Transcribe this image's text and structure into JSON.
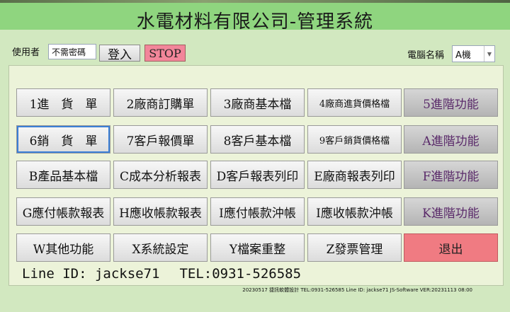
{
  "title": "水電材料有限公司-管理系統",
  "login": {
    "user_label": "使用者",
    "password_value": "不需密碼",
    "login_label": "登入",
    "stop_label": "STOP"
  },
  "computer": {
    "label": "電腦名稱",
    "selected": "A機"
  },
  "menu": [
    [
      "1進　貨　單",
      "2廠商訂購單",
      "3廠商基本檔",
      "4廠商進貨價格檔",
      "5進階功能"
    ],
    [
      "6銷　貨　單",
      "7客戶報價單",
      "8客戶基本檔",
      "9客戶銷貨價格檔",
      "A進階功能"
    ],
    [
      "B產品基本檔",
      "C成本分析報表",
      "D客戶報表列印",
      "E廠商報表列印",
      "F進階功能"
    ],
    [
      "G應付帳款報表",
      "H應收帳款報表",
      "I應付帳款沖帳",
      "I應收帳款沖帳",
      "K進階功能"
    ],
    [
      "W其他功能",
      "X系統設定",
      "Y檔案重整",
      "Z發票管理",
      "退出"
    ]
  ],
  "footer": {
    "line_id": "Line ID: jackse71",
    "tel": "TEL:0931-526585",
    "version": "20230517 捷訊軟體設計 TEL:0931-526585 Line ID: jackse71 JS-Software VER:20231113 08:00"
  }
}
